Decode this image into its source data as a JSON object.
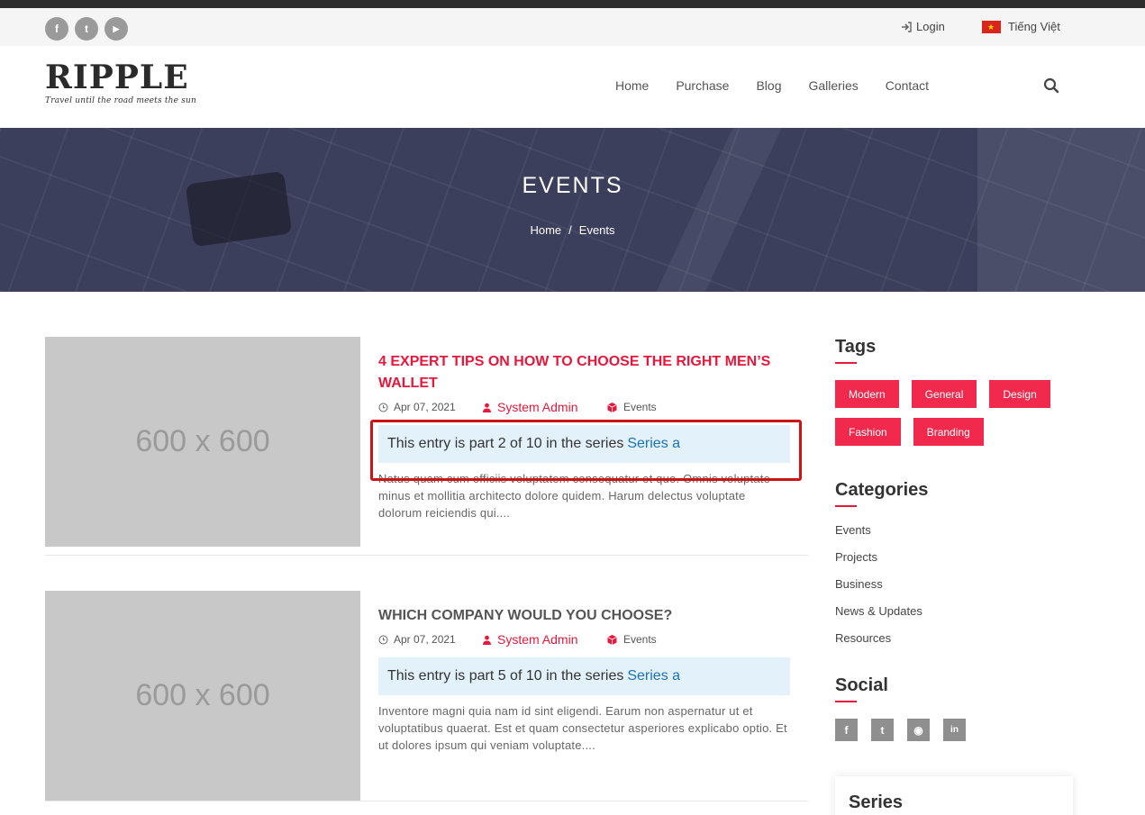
{
  "topbar": {
    "social": [
      {
        "icon": "facebook-icon",
        "glyph": "f"
      },
      {
        "icon": "twitter-icon",
        "glyph": "t"
      },
      {
        "icon": "youtube-icon",
        "glyph": "▶"
      }
    ],
    "login_label": "Login",
    "language_label": "Tiếng Việt"
  },
  "logo": {
    "word": "RIPPLE",
    "tagline": "Travel until the road meets the sun"
  },
  "nav": {
    "items": [
      "Home",
      "Purchase",
      "Blog",
      "Galleries",
      "Contact"
    ],
    "search_icon": "search-icon"
  },
  "banner": {
    "title": "EVENTS",
    "breadcrumb_home": "Home",
    "breadcrumb_sep": "/",
    "breadcrumb_current": "Events"
  },
  "posts": [
    {
      "thumb_text": "600 x 600",
      "title": "4 EXPERT TIPS ON HOW TO CHOOSE THE RIGHT MEN’S WALLET",
      "title_color": "#e8173c",
      "date": "Apr 07, 2021",
      "author": "System Admin",
      "category": "Events",
      "series_text": "This entry is part 2 of 10 in the series",
      "series_link": "Series a",
      "excerpt": "Natus quam cum officiis voluptatem consequatur et quo. Omnis voluptate minus et mollitia architecto dolore quidem. Harum delectus voluptate dolorum reiciendis qui...."
    },
    {
      "thumb_text": "600 x 600",
      "title": "WHICH COMPANY WOULD YOU CHOOSE?",
      "title_color": "#555555",
      "date": "Apr 07, 2021",
      "author": "System Admin",
      "category": "Events",
      "series_text": "This entry is part 5 of 10 in the series",
      "series_link": "Series a",
      "excerpt": "Inventore magni quia nam id sint eligendi. Earum non aspernatur ut et voluptatibus quaerat. Est et quam consectetur asperiores explicabo optio. Et ut dolores ipsum qui veniam voluptate...."
    }
  ],
  "sidebar": {
    "tags_title": "Tags",
    "tags": [
      "Modern",
      "General",
      "Design",
      "Fashion",
      "Branding"
    ],
    "categories_title": "Categories",
    "categories": [
      "Events",
      "Projects",
      "Business",
      "News & Updates",
      "Resources"
    ],
    "social_title": "Social",
    "social": [
      {
        "icon": "facebook-icon",
        "glyph": "f"
      },
      {
        "icon": "twitter-icon",
        "glyph": "t"
      },
      {
        "icon": "github-icon",
        "glyph": "◉"
      },
      {
        "icon": "linkedin-icon",
        "glyph": "in"
      }
    ],
    "series_title": "Series"
  },
  "colors": {
    "accent": "#e8173c",
    "tag_bg": "#f12a4d",
    "series_bg": "#e3f1fb",
    "link": "#1a73b8",
    "highlight": "#cc1414"
  }
}
